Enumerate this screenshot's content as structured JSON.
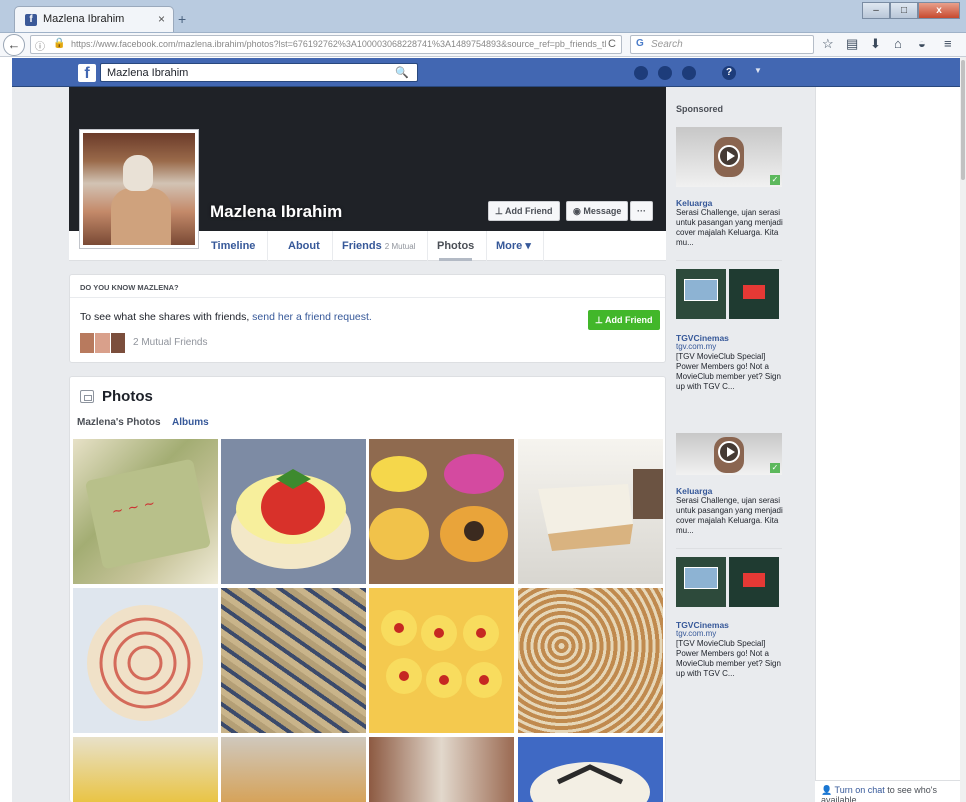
{
  "browser": {
    "tab_title": "Mazlena Ibrahim",
    "tab_close": "×",
    "new_tab": "+",
    "url_host": "https://www.facebook.com",
    "url_path": "/mazlena.ibrahim/photos?lst=676192762%3A100003068228741%3A1489754893&source_ref=pb_friends_tl",
    "search_placeholder": "Search",
    "window_buttons": [
      "–",
      "□",
      "x"
    ]
  },
  "fb": {
    "logo": "f",
    "search_value": "Mazlena Ibrahim",
    "help": "?"
  },
  "profile": {
    "name": "Mazlena Ibrahim",
    "add_friend": "Add Friend",
    "message": "Message",
    "more_dots": "···",
    "tabs": [
      {
        "label": "Timeline"
      },
      {
        "label": "About"
      },
      {
        "label": "Friends",
        "sub": "2 Mutual"
      },
      {
        "label": "Photos"
      },
      {
        "label": "More ▾"
      }
    ]
  },
  "know": {
    "heading": "DO YOU KNOW MAZLENA?",
    "text_prefix": "To see what she shares with friends, ",
    "link": "send her a friend request.",
    "button": "Add Friend",
    "mutual": "2 Mutual Friends"
  },
  "photos": {
    "title": "Photos",
    "tab_mine": "Mazlena's Photos",
    "tab_albums": "Albums",
    "colors": {
      "cake_green": "#9cab6c",
      "strawberry_red": "#d8312a",
      "cake_orange": "#e9a43a",
      "cream": "#f3efe4"
    }
  },
  "sponsored": {
    "title": "Sponsored",
    "ads": [
      {
        "title": "Keluarga",
        "desc": "Serasi Challenge, ujan serasi untuk pasangan yang menjadi cover majalah Keluarga. Kita mu..."
      },
      {
        "title": "TGVCinemas",
        "url": "tgv.com.my",
        "desc": "[TGV MovieClub Special] Power Members go! Not a MovieClub member yet? Sign up with TGV C..."
      },
      {
        "title": "Keluarga",
        "desc": "Serasi Challenge, ujan serasi untuk pasangan yang menjadi cover majalah Keluarga. Kita mu..."
      },
      {
        "title": "TGVCinemas",
        "url": "tgv.com.my",
        "desc": "[TGV MovieClub Special] Power Members go! Not a MovieClub member yet? Sign up with TGV C..."
      }
    ]
  },
  "chat": {
    "link": "Turn on chat",
    "rest": " to see who's available"
  }
}
